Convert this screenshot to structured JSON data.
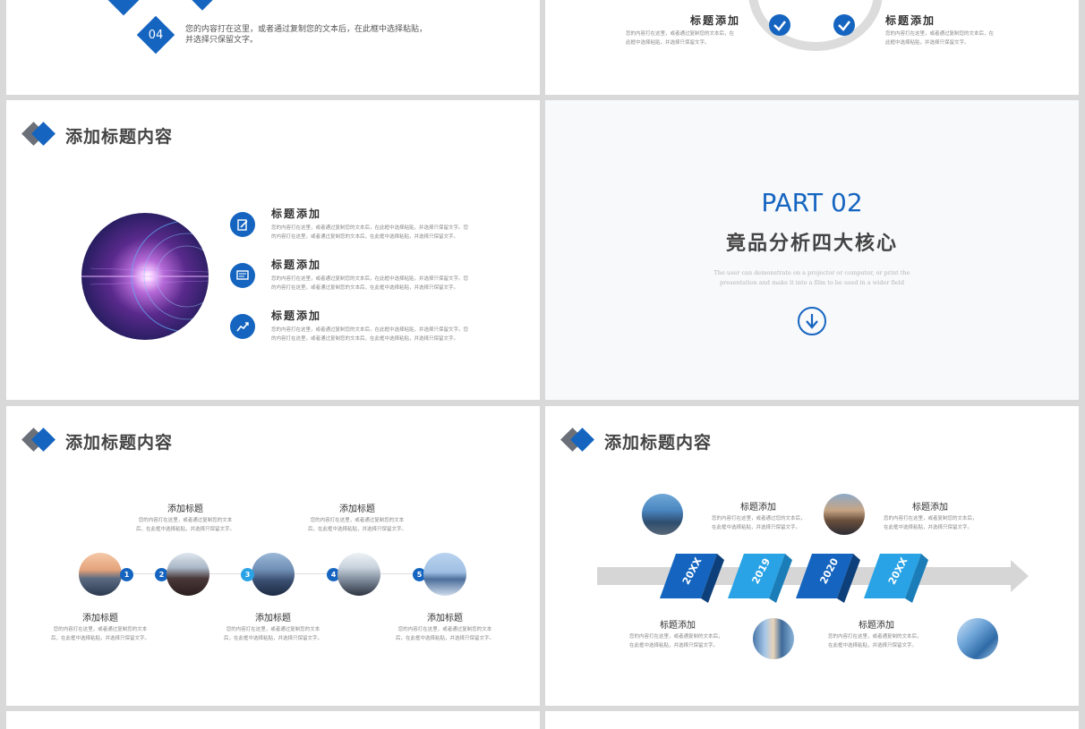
{
  "slide_tl": {
    "number": "04",
    "text_line1": "您的内容打在这里，或者通过复制您的文本后，在此框中选择粘贴，",
    "text_line2": "并选择只保留文字。"
  },
  "slide_tr": {
    "items": [
      {
        "title": "标题添加",
        "line1": "您的内容打在这里，或者通过复制您的文本后，在",
        "line2": "此框中选择粘贴，并选择只保留文字。"
      },
      {
        "title": "标题添加",
        "line1": "您的内容打在这里，或者通过复制您的文本后，在",
        "line2": "此框中选择粘贴，并选择只保留文字。"
      }
    ]
  },
  "slide_ml": {
    "header": "添加标题内容",
    "items": [
      {
        "title": "标题添加",
        "icon": "edit-icon",
        "line1": "您的内容打在这里，或者通过复制您的文本后，在此框中选择粘贴，并选择只保留文字。您",
        "line2": "的内容打在这里，或者通过复制您的文本后，在此框中选择粘贴，并选择只保留文字。"
      },
      {
        "title": "标题添加",
        "icon": "document-icon",
        "line1": "您的内容打在这里，或者通过复制您的文本后，在此框中选择粘贴，并选择只保留文字。您",
        "line2": "的内容打在这里，或者通过复制您的文本后，在此框中选择粘贴，并选择只保留文字。"
      },
      {
        "title": "标题添加",
        "icon": "trend-chart-icon",
        "line1": "您的内容打在这里，或者通过复制您的文本后，在此框中选择粘贴，并选择只保留文字。您",
        "line2": "的内容打在这里，或者通过复制您的文本后，在此框中选择粘贴，并选择只保留文字。"
      }
    ]
  },
  "slide_mr": {
    "part": "PART 02",
    "title": "竟品分析四大核心",
    "en_line1": "The user can demonstrate on a projector or computer, or print the",
    "en_line2": "presentation and make it into a film to be used in a wider field",
    "icon": "arrow-down-circle-icon"
  },
  "slide_bl": {
    "header": "添加标题内容",
    "numbers": [
      "1",
      "2",
      "3",
      "4",
      "5"
    ],
    "top_items": [
      {
        "title": "添加标题",
        "line1": "您的内容打在这里，或者通过复制您的文本",
        "line2": "后，在此框中选择粘贴，并选择只保留文字。"
      },
      {
        "title": "添加标题",
        "line1": "您的内容打在这里，或者通过复制您的文本",
        "line2": "后，在此框中选择粘贴，并选择只保留文字。"
      }
    ],
    "bottom_items": [
      {
        "title": "添加标题",
        "line1": "您的内容打在这里，或者通过复制您的文本",
        "line2": "后，在此框中选择粘贴，并选择只保留文字。"
      },
      {
        "title": "添加标题",
        "line1": "您的内容打在这里，或者通过复制您的文本",
        "line2": "后，在此框中选择粘贴，并选择只保留文字。"
      },
      {
        "title": "添加标题",
        "line1": "您的内容打在这里，或者通过复制您的文本",
        "line2": "后，在此框中选择粘贴，并选择只保留文字。"
      }
    ]
  },
  "slide_br": {
    "header": "添加标题内容",
    "years": [
      "20XX",
      "2019",
      "2020",
      "20XX"
    ],
    "top_items": [
      {
        "title": "标题添加",
        "line1": "您的内容打在这里，或者通过您的文本后，",
        "line2": "在此框中选择粘贴，并选择只保留文字。"
      },
      {
        "title": "标题添加",
        "line1": "您的内容打在这里，或者复制您的文本后，",
        "line2": "在此框中选择粘贴，并选择只保留文字。"
      }
    ],
    "bottom_items": [
      {
        "title": "标题添加",
        "line1": "您的内容打在这里，或者通复制的文本后，",
        "line2": "在此框中选择粘贴，并选择只保留文字。"
      },
      {
        "title": "标题添加",
        "line1": "您的内容打在这里，或者通复制的文本后，",
        "line2": "在此框中选择粘贴，并选择只保留文字。"
      }
    ]
  },
  "colors": {
    "primary": "#1565c0",
    "accent": "#29a3e6",
    "grey": "#d6d6d6"
  }
}
